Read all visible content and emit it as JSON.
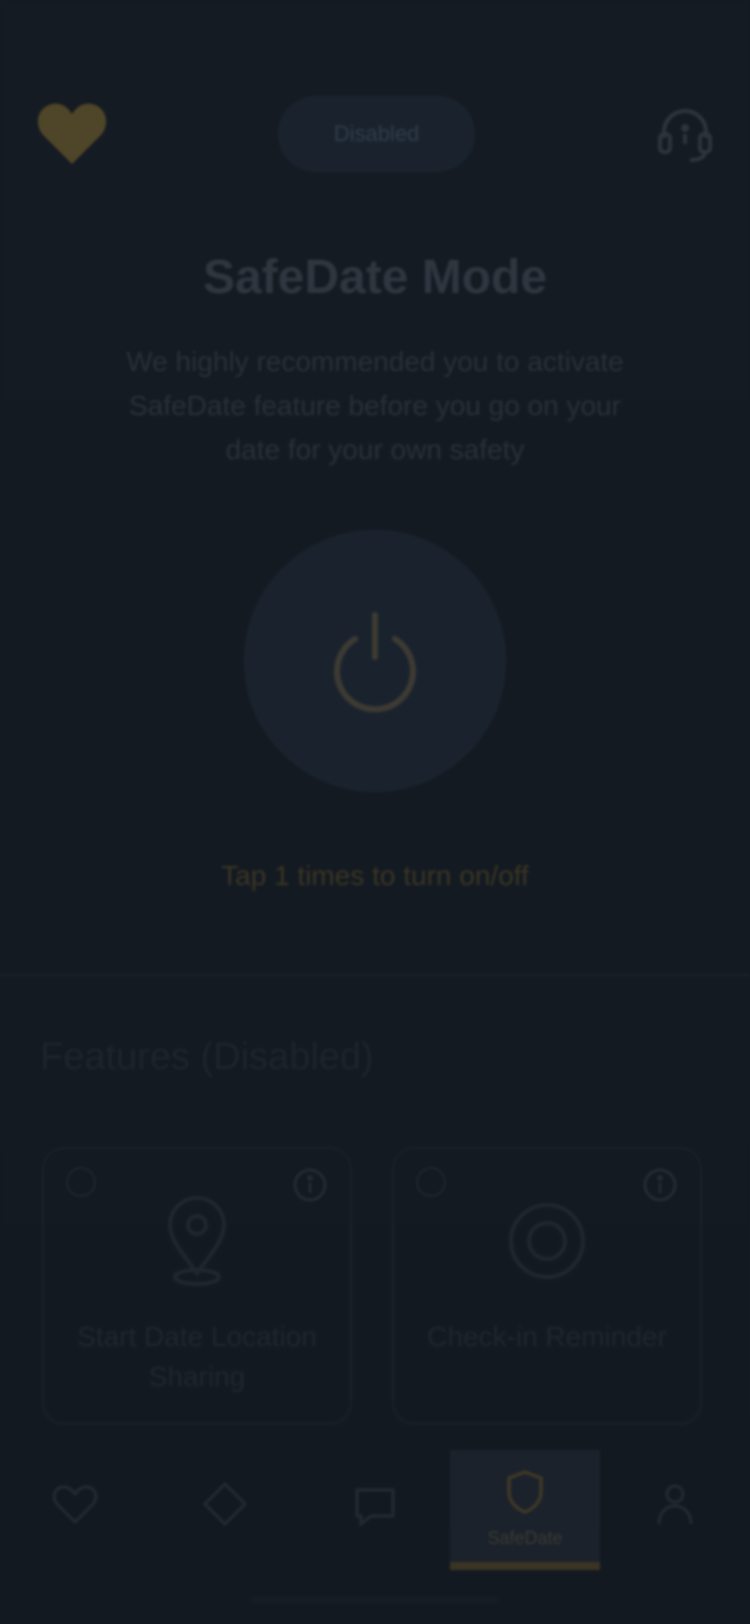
{
  "header": {
    "status_label": "Disabled",
    "logo_icon": "heart-icon",
    "support_icon": "headset-icon"
  },
  "hero": {
    "title": "SafeDate Mode",
    "description": "We highly recommended you to activate SafeDate feature before you go on your date for your own safety",
    "power_icon": "power-icon",
    "tap_hint": "Tap 1 times to turn on/off"
  },
  "features": {
    "title": "Features (Disabled)",
    "cards": [
      {
        "label": "Start Date Location Sharing",
        "icon": "location-pin-icon"
      },
      {
        "label": "Check-in Reminder",
        "icon": "target-icon"
      }
    ]
  },
  "bottom_nav": {
    "items": [
      {
        "icon": "heart-outline-icon",
        "label": ""
      },
      {
        "icon": "diamond-icon",
        "label": ""
      },
      {
        "icon": "chat-icon",
        "label": ""
      },
      {
        "icon": "shield-icon",
        "label": "SafeDate"
      },
      {
        "icon": "person-icon",
        "label": ""
      }
    ],
    "active_index": 3
  },
  "colors": {
    "background": "#141a22",
    "accent_gold": "#5c4f2a",
    "surface": "#1a232d"
  }
}
